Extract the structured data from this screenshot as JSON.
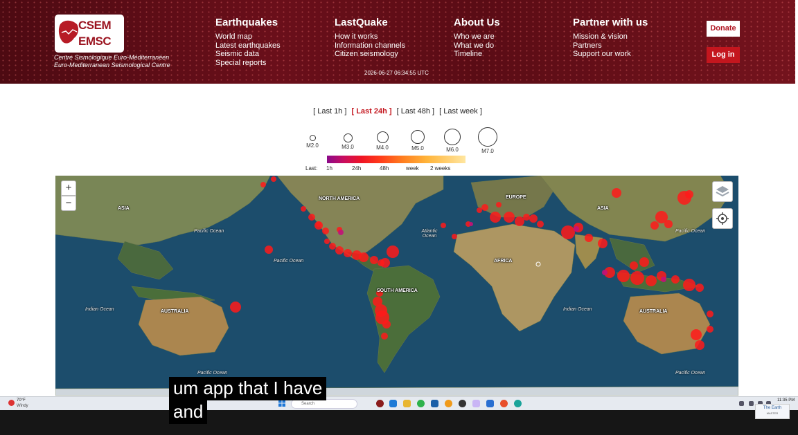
{
  "header": {
    "logo": {
      "top": "CSEM",
      "bottom": "EMSC"
    },
    "caption_line1": "Centre Sismologique Euro-Méditerranéen",
    "caption_line2": "Euro-Mediterranean Seismological Centre",
    "nav": [
      {
        "title": "Earthquakes",
        "links": [
          "World map",
          "Latest earthquakes",
          "Seismic data",
          "Special reports"
        ]
      },
      {
        "title": "LastQuake",
        "links": [
          "How it works",
          "Information channels",
          "Citizen seismology"
        ]
      },
      {
        "title": "About Us",
        "links": [
          "Who we are",
          "What we do",
          "Timeline"
        ]
      },
      {
        "title": "Partner with us",
        "links": [
          "Mission & vision",
          "Partners",
          "Support our work"
        ]
      }
    ],
    "timestamp": "2026-06-27 06:34:55 UTC",
    "donate": "Donate",
    "login": "Log in"
  },
  "time_filter": [
    {
      "label": "[ Last 1h ]",
      "active": false
    },
    {
      "label": "[ Last 24h ]",
      "active": true
    },
    {
      "label": "[ Last 48h ]",
      "active": false
    },
    {
      "label": "[ Last week ]",
      "active": false
    }
  ],
  "legend": {
    "magnitudes": [
      "M2.0",
      "M3.0",
      "M4.0",
      "M5.0",
      "M6.0",
      "M7.0"
    ],
    "age_label": "Last:",
    "age_ticks": [
      "1h",
      "24h",
      "48h",
      "week",
      "2 weeks"
    ]
  },
  "map": {
    "zoom_in": "+",
    "zoom_out": "−",
    "continents": [
      "ASIA",
      "NORTH AMERICA",
      "EUROPE",
      "ASIA",
      "AFRICA",
      "SOUTH AMERICA",
      "AUSTRALIA",
      "AUSTRALIA"
    ],
    "oceans": [
      "Pacific Ocean",
      "Pacific Ocean",
      "Atlantic Ocean",
      "Indian Ocean",
      "Indian Ocean",
      "Pacific Ocean",
      "Pacific Ocean",
      "Pacific Ocean"
    ]
  },
  "caption": {
    "line1": "um app that I have",
    "line2": "and"
  },
  "taskbar": {
    "weather_temp": "70°F",
    "weather_cond": "Windy",
    "search": "Search",
    "clock": "11:35 PM",
    "badge_title": "The Earth",
    "badge_sub": "MASTER"
  }
}
